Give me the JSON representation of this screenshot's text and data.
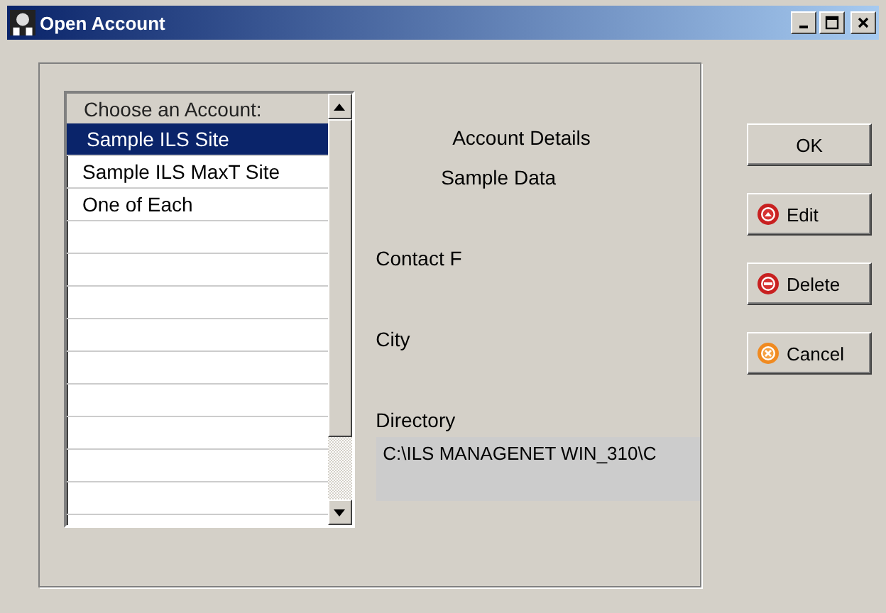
{
  "window": {
    "title": "Open Account"
  },
  "account_list": {
    "header": "Choose an Account:",
    "items": [
      {
        "label": "Sample ILS Site",
        "selected": true
      },
      {
        "label": "Sample ILS MaxT Site",
        "selected": false
      },
      {
        "label": "One of Each",
        "selected": false
      }
    ]
  },
  "details": {
    "title": "Account Details",
    "name": "Sample Data",
    "fields": [
      {
        "label": "Contact F"
      },
      {
        "label": "City"
      },
      {
        "label": "Directory",
        "value": "C:\\ILS MANAGENET WIN_310\\C"
      }
    ]
  },
  "buttons": [
    {
      "label": "OK",
      "kind": "plain"
    },
    {
      "label": "Edit",
      "kind": "edit"
    },
    {
      "label": "Delete",
      "kind": "delete"
    },
    {
      "label": "Cancel",
      "kind": "cancel"
    }
  ]
}
